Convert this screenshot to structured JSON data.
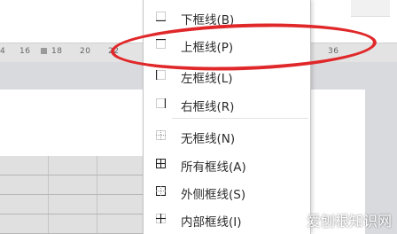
{
  "ruler": {
    "ticks": [
      "4",
      "16",
      "18",
      "20",
      "22",
      "36"
    ]
  },
  "border_menu": {
    "items": [
      {
        "label": "下框线(B)",
        "icon": "bottom-border-icon"
      },
      {
        "label": "上框线(P)",
        "icon": "top-border-icon"
      },
      {
        "label": "左框线(L)",
        "icon": "left-border-icon"
      },
      {
        "label": "右框线(R)",
        "icon": "right-border-icon"
      },
      {
        "label": "无框线(N)",
        "icon": "no-border-icon"
      },
      {
        "label": "所有框线(A)",
        "icon": "all-borders-icon"
      },
      {
        "label": "外侧框线(S)",
        "icon": "outside-borders-icon"
      },
      {
        "label": "内部框线(I)",
        "icon": "inside-borders-icon"
      }
    ]
  },
  "highlight_color": "#e0282a",
  "watermark": "爱刨根知识网"
}
